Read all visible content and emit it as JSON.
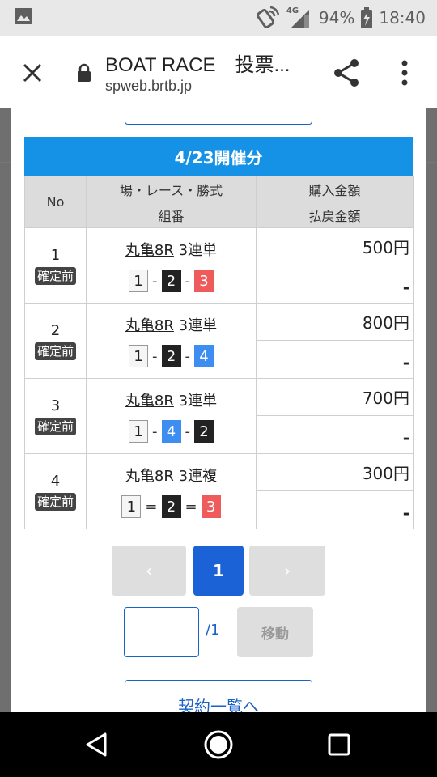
{
  "status_bar": {
    "network": "4G",
    "battery": "94%",
    "time": "18:40"
  },
  "browser": {
    "title": "BOAT RACE　投票...",
    "url": "spweb.brtb.jp"
  },
  "section": {
    "date_header": "4/23開催分"
  },
  "table": {
    "headers": {
      "no": "No",
      "race": "場・レース・勝式",
      "combination": "組番",
      "purchase": "購入金額",
      "payout": "払戻金額"
    },
    "rows": [
      {
        "no": "1",
        "status": "確定前",
        "venue": "丸亀8R",
        "bet_type": "3連単",
        "combo": [
          "1",
          "2",
          "3"
        ],
        "sep": "-",
        "purchase": "500円",
        "payout": "-"
      },
      {
        "no": "2",
        "status": "確定前",
        "venue": "丸亀8R",
        "bet_type": "3連単",
        "combo": [
          "1",
          "2",
          "4"
        ],
        "sep": "-",
        "purchase": "800円",
        "payout": "-"
      },
      {
        "no": "3",
        "status": "確定前",
        "venue": "丸亀8R",
        "bet_type": "3連単",
        "combo": [
          "1",
          "4",
          "2"
        ],
        "sep": "-",
        "purchase": "700円",
        "payout": "-"
      },
      {
        "no": "4",
        "status": "確定前",
        "venue": "丸亀8R",
        "bet_type": "3連複",
        "combo": [
          "1",
          "2",
          "3"
        ],
        "sep": "=",
        "purchase": "300円",
        "payout": "-"
      }
    ]
  },
  "pager": {
    "prev": "‹",
    "current": "1",
    "next": "›",
    "total": "/1",
    "jump_value": "",
    "jump_label": "移動"
  },
  "footer": {
    "list_button": "契約一覧へ"
  },
  "colors": {
    "header_blue": "#1592e6",
    "primary_blue": "#1a62d6",
    "boat1": "#f5f5f5",
    "boat2": "#222222",
    "boat3": "#ef5a5a",
    "boat4": "#3d8ef0"
  },
  "icons": {
    "status": [
      "gallery-icon",
      "wifi-calling-icon",
      "signal-icon",
      "battery-charging-icon"
    ],
    "browser": [
      "close-icon",
      "lock-icon",
      "share-icon",
      "more-vert-icon"
    ],
    "nav": [
      "back-icon",
      "home-icon",
      "recents-icon"
    ]
  }
}
